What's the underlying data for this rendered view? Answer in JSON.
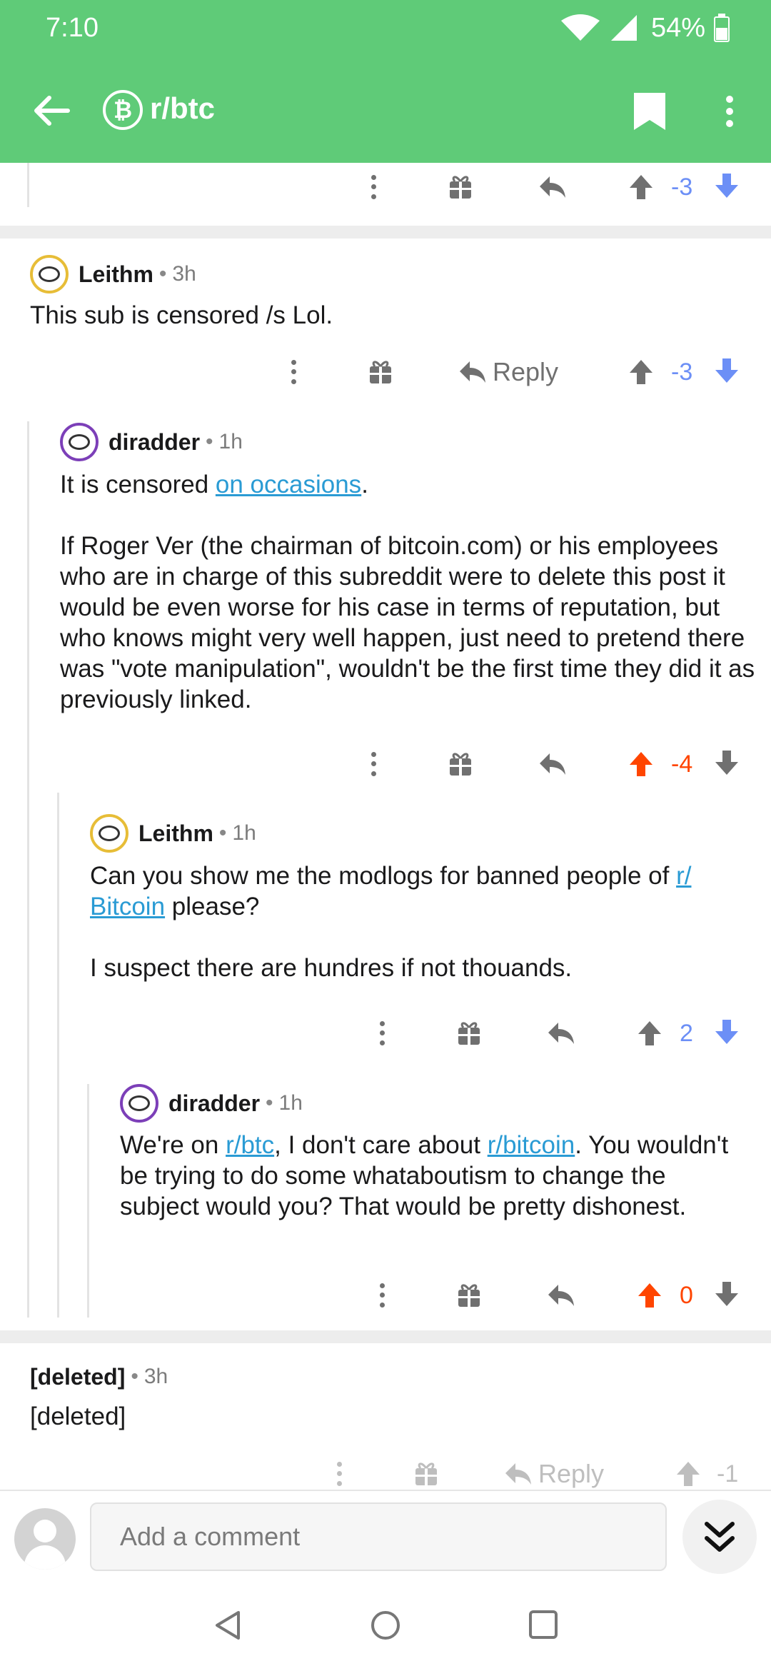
{
  "status_bar": {
    "time": "7:10",
    "battery": "54%"
  },
  "toolbar": {
    "subreddit": "r/btc",
    "sub_icon_glyph": "₿"
  },
  "colors": {
    "header": "#5fcb78",
    "link": "#2a9bd4",
    "upvote_orange": "#ff4500",
    "downvote_blue": "#6c8ff6",
    "score_blue": "#6c8ff6",
    "icon_gray": "#707070"
  },
  "top_partial": {
    "score": "-3"
  },
  "comments": [
    {
      "author": "Leithm",
      "time": "3h",
      "avatar": "gold",
      "paragraphs": [
        [
          {
            "t": "This sub is censored /s  Lol."
          }
        ]
      ],
      "reply_label": "Reply",
      "score": "-3",
      "vote": "down"
    },
    {
      "author": "diradder",
      "time": "1h",
      "avatar": "purple",
      "paragraphs": [
        [
          {
            "t": "It is censored "
          },
          {
            "t": "on occasions",
            "link": true
          },
          {
            "t": "."
          }
        ],
        [
          {
            "t": "If Roger Ver (the chairman of bitcoin.com) or his employees who are in charge of this subreddit were to delete this post it would be even worse for his case in terms of reputation, but who knows might very well happen, just need to pretend there was \"vote manipulation\", wouldn't be the first time they did it as previously linked."
          }
        ]
      ],
      "score": "-4",
      "vote": "up"
    },
    {
      "author": "Leithm",
      "time": "1h",
      "avatar": "gold",
      "paragraphs": [
        [
          {
            "t": "Can you show me the modlogs for banned people of "
          },
          {
            "t": "r/",
            "link": true
          },
          {
            "br": true
          },
          {
            "t": "Bitcoin",
            "link": true
          },
          {
            "t": " please?"
          }
        ],
        [
          {
            "t": "I suspect there are hundres if not thouands."
          }
        ]
      ],
      "score": "2",
      "vote": "down"
    },
    {
      "author": "diradder",
      "time": "1h",
      "avatar": "purple",
      "paragraphs": [
        [
          {
            "t": "We're on "
          },
          {
            "t": "r/btc",
            "link": true
          },
          {
            "t": ", I don't care about "
          },
          {
            "t": "r/bitcoin",
            "link": true
          },
          {
            "t": ". You wouldn't be trying to do some whataboutism to change the subject would you? That would be pretty dishonest."
          }
        ]
      ],
      "score": "0",
      "vote": "up"
    },
    {
      "author": "[deleted]",
      "time": "3h",
      "avatar": "none",
      "paragraphs": [
        [
          {
            "t": "[deleted]"
          }
        ]
      ],
      "reply_label": "Reply",
      "score": "-1",
      "vote": "none"
    }
  ],
  "composer": {
    "placeholder": "Add a comment"
  }
}
